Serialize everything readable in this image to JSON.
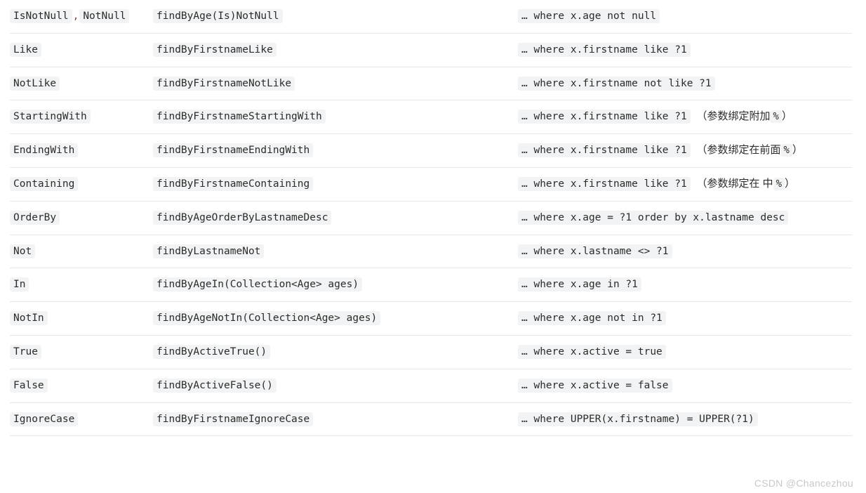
{
  "table": {
    "rows": [
      {
        "keywords": [
          "IsNotNull",
          "NotNull"
        ],
        "separator": ",",
        "sample": "findByAge(Is)NotNull",
        "snippet": "… where x.age not null",
        "note_before": "",
        "note_code": "",
        "note_after": ""
      },
      {
        "keywords": [
          "Like"
        ],
        "separator": "",
        "sample": "findByFirstnameLike",
        "snippet": "… where x.firstname like ?1",
        "note_before": "",
        "note_code": "",
        "note_after": ""
      },
      {
        "keywords": [
          "NotLike"
        ],
        "separator": "",
        "sample": "findByFirstnameNotLike",
        "snippet": "… where x.firstname not like ?1",
        "note_before": "",
        "note_code": "",
        "note_after": ""
      },
      {
        "keywords": [
          "StartingWith"
        ],
        "separator": "",
        "sample": "findByFirstnameStartingWith",
        "snippet": "… where x.firstname like ?1",
        "note_before": "（参数绑定附加",
        "note_code": "%",
        "note_after": "）"
      },
      {
        "keywords": [
          "EndingWith"
        ],
        "separator": "",
        "sample": "findByFirstnameEndingWith",
        "snippet": "… where x.firstname like ?1",
        "note_before": "（参数绑定在前面",
        "note_code": "%",
        "note_after": "）"
      },
      {
        "keywords": [
          "Containing"
        ],
        "separator": "",
        "sample": "findByFirstnameContaining",
        "snippet": "… where x.firstname like ?1",
        "note_before": "（参数绑定在 中",
        "note_code": "%",
        "note_after": "）"
      },
      {
        "keywords": [
          "OrderBy"
        ],
        "separator": "",
        "sample": "findByAgeOrderByLastnameDesc",
        "snippet": "… where x.age = ?1 order by x.lastname desc",
        "note_before": "",
        "note_code": "",
        "note_after": ""
      },
      {
        "keywords": [
          "Not"
        ],
        "separator": "",
        "sample": "findByLastnameNot",
        "snippet": "… where x.lastname <> ?1",
        "note_before": "",
        "note_code": "",
        "note_after": ""
      },
      {
        "keywords": [
          "In"
        ],
        "separator": "",
        "sample": "findByAgeIn(Collection<Age> ages)",
        "snippet": "… where x.age in ?1",
        "note_before": "",
        "note_code": "",
        "note_after": ""
      },
      {
        "keywords": [
          "NotIn"
        ],
        "separator": "",
        "sample": "findByAgeNotIn(Collection<Age> ages)",
        "snippet": "… where x.age not in ?1",
        "note_before": "",
        "note_code": "",
        "note_after": ""
      },
      {
        "keywords": [
          "True"
        ],
        "separator": "",
        "sample": "findByActiveTrue()",
        "snippet": "… where x.active = true",
        "note_before": "",
        "note_code": "",
        "note_after": ""
      },
      {
        "keywords": [
          "False"
        ],
        "separator": "",
        "sample": "findByActiveFalse()",
        "snippet": "… where x.active = false",
        "note_before": "",
        "note_code": "",
        "note_after": ""
      },
      {
        "keywords": [
          "IgnoreCase"
        ],
        "separator": "",
        "sample": "findByFirstnameIgnoreCase",
        "snippet": "… where UPPER(x.firstname) = UPPER(?1)",
        "note_before": "",
        "note_code": "",
        "note_after": ""
      }
    ]
  },
  "watermark": {
    "text": "CSDN @Chancezhou"
  },
  "colors": {
    "code_background": "#f2f3f4",
    "code_text": "#2b2b2b",
    "row_divider": "#e8e8e8",
    "watermark_text": "#c8c8c8",
    "page_background": "#ffffff"
  }
}
